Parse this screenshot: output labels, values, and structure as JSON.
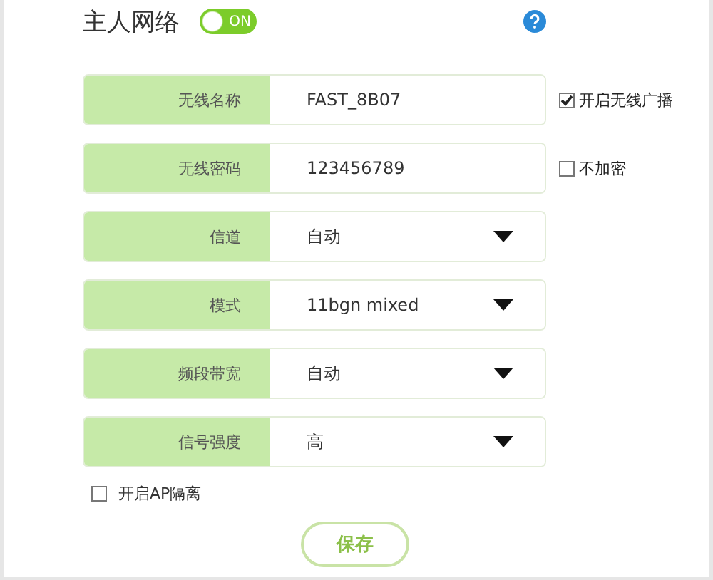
{
  "header": {
    "title": "主人网络",
    "toggle": {
      "label": "ON",
      "on": true
    }
  },
  "fields": [
    {
      "kind": "text",
      "label": "无线名称",
      "value": "FAST_8B07",
      "option": {
        "label": "开启无线广播",
        "checked": true
      }
    },
    {
      "kind": "text",
      "label": "无线密码",
      "value": "123456789",
      "option": {
        "label": "不加密",
        "checked": false
      }
    },
    {
      "kind": "select",
      "label": "信道",
      "value": "自动"
    },
    {
      "kind": "select",
      "label": "模式",
      "value": "11bgn mixed"
    },
    {
      "kind": "select",
      "label": "频段带宽",
      "value": "自动"
    },
    {
      "kind": "select",
      "label": "信号强度",
      "value": "高"
    }
  ],
  "ap_isolation": {
    "label": "开启AP隔离",
    "checked": false
  },
  "save_button": "保存"
}
